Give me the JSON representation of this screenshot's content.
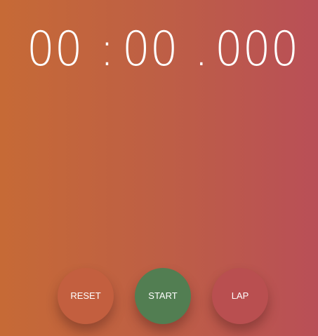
{
  "timer": {
    "minutes": "00",
    "separator_min_sec": ":",
    "seconds": "00",
    "separator_sec_ms": ".",
    "milliseconds": "000"
  },
  "controls": {
    "reset_label": "RESET",
    "start_label": "START",
    "lap_label": "LAP"
  },
  "colors": {
    "background_left": "#c66a36",
    "background_right": "#b94f57",
    "reset_button": "#c35f3f",
    "start_button": "#527e52",
    "lap_button": "#b94f50",
    "text": "#ffffff"
  }
}
